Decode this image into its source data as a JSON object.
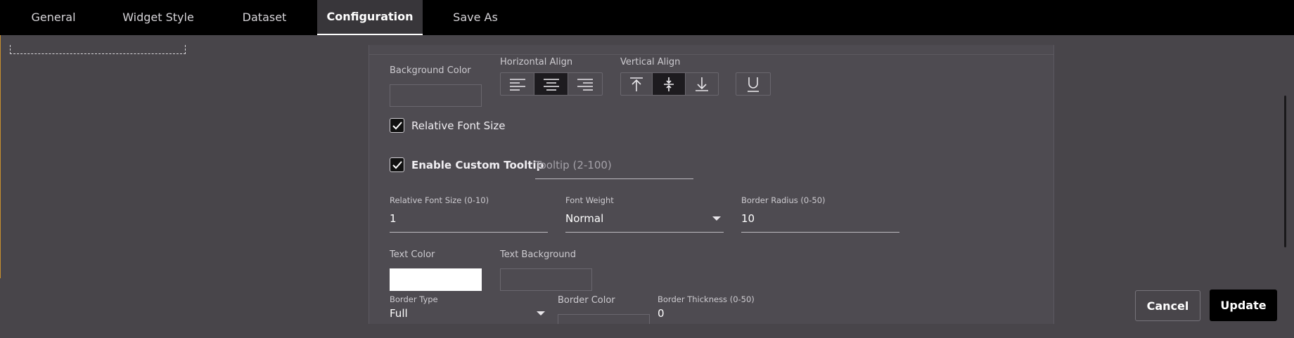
{
  "tabs": [
    {
      "label": "General"
    },
    {
      "label": "Widget Style"
    },
    {
      "label": "Dataset"
    },
    {
      "label": "Configuration",
      "active": true
    },
    {
      "label": "Save As"
    }
  ],
  "config": {
    "background_color_label": "Background Color",
    "horizontal_align_label": "Horizontal Align",
    "vertical_align_label": "Vertical Align",
    "horizontal_align_selected": "center",
    "vertical_align_selected": "middle",
    "relative_font_size_check": {
      "label": "Relative Font Size",
      "checked": true
    },
    "custom_tooltip_check": {
      "label": "Enable Custom Tooltip",
      "checked": true
    },
    "tooltip_placeholder": "Tooltip (2-100)",
    "relative_font_size": {
      "label": "Relative Font Size (0-10)",
      "value": "1"
    },
    "font_weight": {
      "label": "Font Weight",
      "value": "Normal"
    },
    "border_radius": {
      "label": "Border Radius (0-50)",
      "value": "10"
    },
    "text_color_label": "Text Color",
    "text_color": "#ffffff",
    "text_background_label": "Text Background",
    "border_type": {
      "label": "Border Type",
      "value": "Full"
    },
    "border_color_label": "Border Color",
    "border_thickness": {
      "label": "Border Thickness (0-50)",
      "value": "0"
    }
  },
  "footer": {
    "cancel_label": "Cancel",
    "update_label": "Update"
  },
  "icons": [
    "align-left-icon",
    "align-center-icon",
    "align-right-icon",
    "align-top-icon",
    "align-middle-icon",
    "align-bottom-icon",
    "underline-icon",
    "check-icon",
    "dropdown-caret-icon"
  ]
}
